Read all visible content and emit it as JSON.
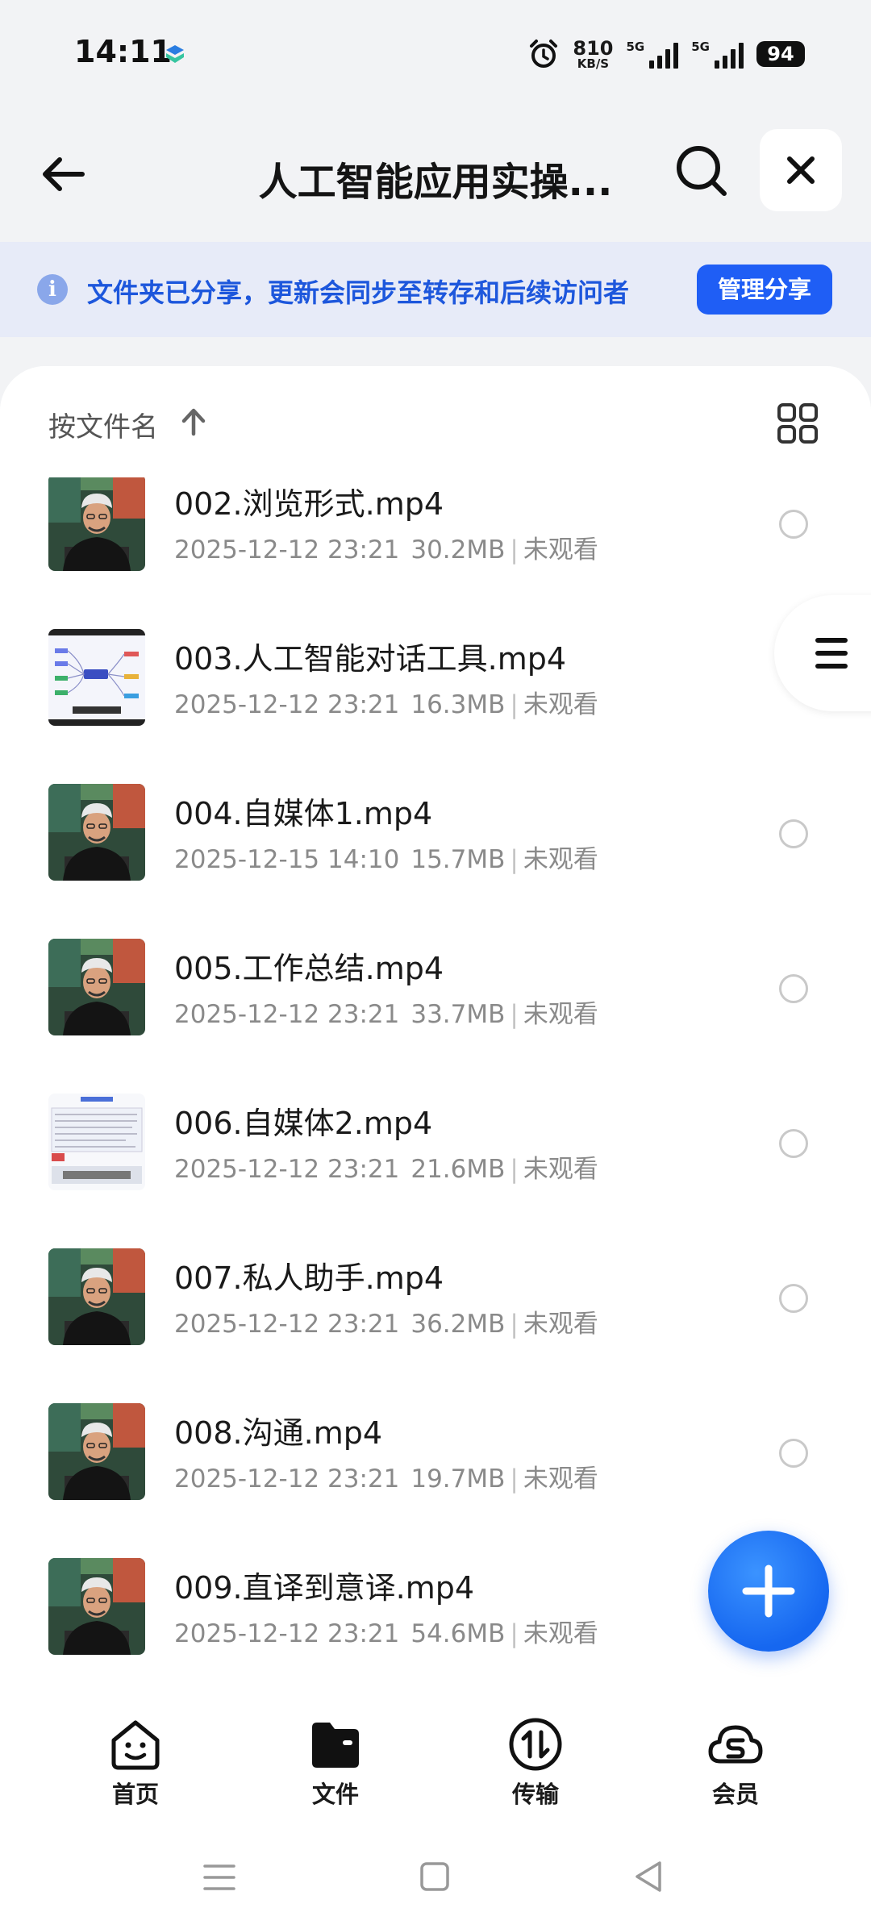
{
  "status_bar": {
    "time": "14:11",
    "net_speed_value": "810",
    "net_speed_unit": "KB/S",
    "signal1_label": "5G",
    "signal2_label": "5G",
    "battery": "94"
  },
  "header": {
    "title": "人工智能应用实操...",
    "back_icon": "arrow-left-icon",
    "search_icon": "search-icon",
    "close_icon": "close-icon"
  },
  "share_banner": {
    "text": "文件夹已分享，更新会同步至转存和后续访问者",
    "button_label": "管理分享"
  },
  "sort": {
    "label": "按文件名",
    "direction_icon": "arrow-up-icon",
    "view_icon": "grid-view-icon"
  },
  "files": [
    {
      "name": "002.浏览形式.mp4",
      "date": "2025-12-12 23:21",
      "size": "30.2MB",
      "status": "未观看",
      "thumb": "video"
    },
    {
      "name": "003.人工智能对话工具.mp4",
      "date": "2025-12-12 23:21",
      "size": "16.3MB",
      "status": "未观看",
      "thumb": "mindmap"
    },
    {
      "name": "004.自媒体1.mp4",
      "date": "2025-12-15 14:10",
      "size": "15.7MB",
      "status": "未观看",
      "thumb": "video"
    },
    {
      "name": "005.工作总结.mp4",
      "date": "2025-12-12 23:21",
      "size": "33.7MB",
      "status": "未观看",
      "thumb": "video"
    },
    {
      "name": "006.自媒体2.mp4",
      "date": "2025-12-12 23:21",
      "size": "21.6MB",
      "status": "未观看",
      "thumb": "document"
    },
    {
      "name": "007.私人助手.mp4",
      "date": "2025-12-12 23:21",
      "size": "36.2MB",
      "status": "未观看",
      "thumb": "video"
    },
    {
      "name": "008.沟通.mp4",
      "date": "2025-12-12 23:21",
      "size": "19.7MB",
      "status": "未观看",
      "thumb": "video"
    },
    {
      "name": "009.直译到意译.mp4",
      "date": "2025-12-12 23:21",
      "size": "54.6MB",
      "status": "未观看",
      "thumb": "video"
    }
  ],
  "bottom_nav": [
    {
      "label": "首页",
      "icon": "home-face-icon"
    },
    {
      "label": "文件",
      "icon": "folder-icon",
      "active": true
    },
    {
      "label": "传输",
      "icon": "transfer-icon"
    },
    {
      "label": "会员",
      "icon": "vip-cloud-icon"
    }
  ],
  "colors": {
    "accent": "#1f5ef5",
    "banner_bg": "#e7ebf8",
    "banner_text": "#1d57dc"
  }
}
